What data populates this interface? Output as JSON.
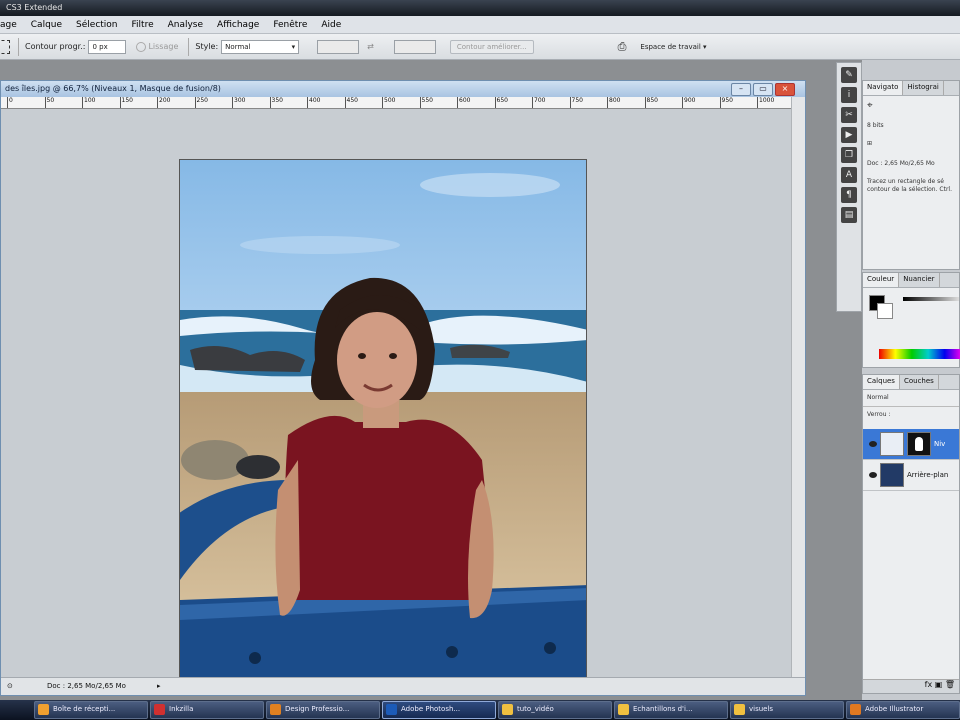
{
  "app": {
    "title": "CS3 Extended"
  },
  "menubar": {
    "items": [
      "age",
      "Calque",
      "Sélection",
      "Filtre",
      "Analyse",
      "Affichage",
      "Fenêtre",
      "Aide"
    ]
  },
  "options": {
    "contour_label": "Contour progr.:",
    "contour_value": "0 px",
    "lisse": "Lissage",
    "style_label": "Style:",
    "style_value": "Normal",
    "refine_button": "Contour améliorer...",
    "workspace": "Espace de travail"
  },
  "document": {
    "title": "des îles.jpg @ 66,7% (Niveaux 1, Masque de fusion/8)",
    "status": "Doc : 2,65 Mo/2,65 Mo",
    "ruler_ticks": [
      "0",
      "50",
      "100",
      "150",
      "200",
      "250",
      "300",
      "350",
      "400",
      "450",
      "500",
      "550",
      "600",
      "650",
      "700",
      "750",
      "800",
      "850",
      "900",
      "950",
      "1000"
    ]
  },
  "panels": {
    "navigator": {
      "tabs": [
        "Navigato",
        "Histograi"
      ],
      "info_bits": "8 bits",
      "doc": "Doc : 2,65 Mo/2,65 Mo",
      "hint": "Tracez un rectangle de sé contour de la sélection. Ctrl."
    },
    "color": {
      "tabs": [
        "Couleur",
        "Nuancier"
      ]
    },
    "layers": {
      "tabs": [
        "Calques",
        "Couches"
      ],
      "blend": "Normal",
      "lock": "Verrou :",
      "items": [
        {
          "name": "Niv",
          "selected": true
        },
        {
          "name": "Arrière-plan",
          "selected": false
        }
      ]
    }
  },
  "taskbar": {
    "items": [
      {
        "label": "Boîte de récepti...",
        "color": "#f0a030"
      },
      {
        "label": "Inkzilla",
        "color": "#d03030"
      },
      {
        "label": "Design Professio...",
        "color": "#e08020"
      },
      {
        "label": "Adobe Photosh...",
        "color": "#1c5bb8",
        "active": true
      },
      {
        "label": "tuto_vidéo",
        "color": "#f0c040"
      },
      {
        "label": "Echantillons d'i...",
        "color": "#f0c040"
      },
      {
        "label": "visuels",
        "color": "#f0c040"
      },
      {
        "label": "Adobe Illustrator",
        "color": "#e07820"
      }
    ]
  }
}
